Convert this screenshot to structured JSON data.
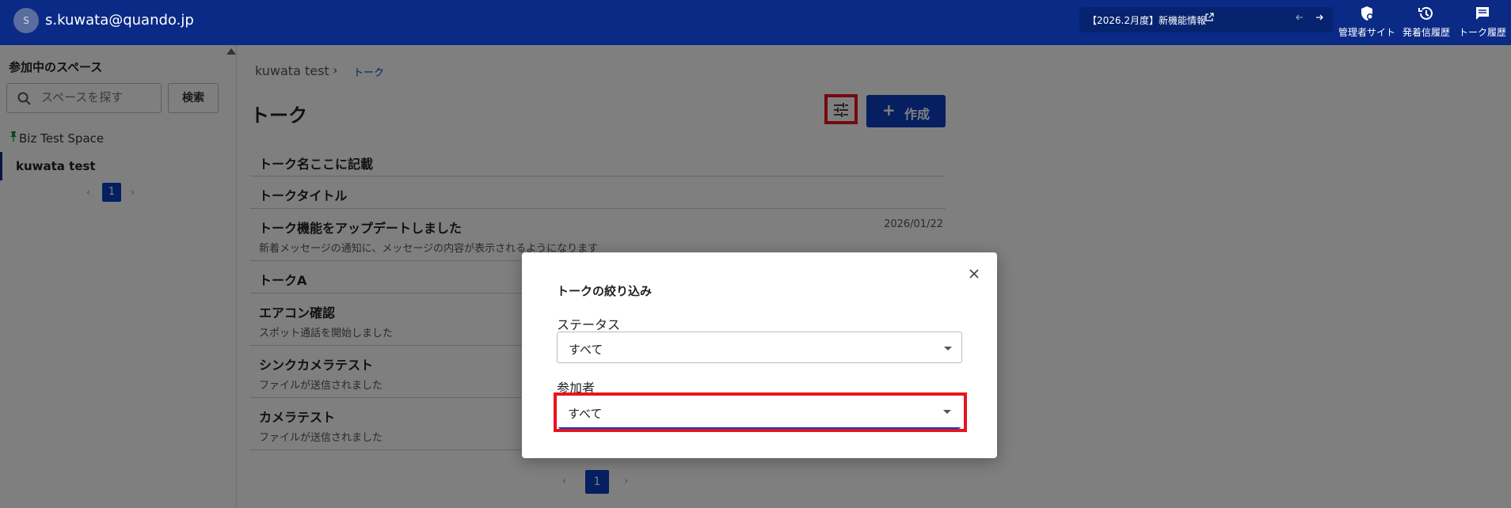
{
  "header": {
    "avatar_initial": "S",
    "user_email": "s.kuwata@quando.jp",
    "news_text": "【2026.2月度】新機能情報",
    "admin_site_label": "管理者サイト",
    "send_history_label": "発着信履歴",
    "talk_history_label": "トーク履歴",
    "bg_color": "#0a2a86"
  },
  "sidebar": {
    "title": "参加中のスペース",
    "search_placeholder": "スペースを探す",
    "search_button": "検索",
    "spaces": [
      {
        "label": "Biz Test Space",
        "pinned": true
      },
      {
        "label": "kuwata test",
        "active": true
      }
    ],
    "page": "1"
  },
  "main": {
    "breadcrumb_root": "kuwata test",
    "breadcrumb_sep": "›",
    "breadcrumb_current": "トーク",
    "title": "トーク",
    "create_label": "作成",
    "talks": [
      {
        "title": "トーク名ここに記載",
        "subtitle": "",
        "date": ""
      },
      {
        "title": "トークタイトル",
        "subtitle": "",
        "date": ""
      },
      {
        "title": "トーク機能をアップデートしました",
        "subtitle": "新着メッセージの通知に、メッセージの内容が表示されるようになります",
        "date": "2026/01/22"
      },
      {
        "title": "トークA",
        "subtitle": "",
        "date": ""
      },
      {
        "title": "エアコン確認",
        "subtitle": "スポット通話を開始しました",
        "date": ""
      },
      {
        "title": "シンクカメラテスト",
        "subtitle": "ファイルが送信されました",
        "date": ""
      },
      {
        "title": "カメラテスト",
        "subtitle": "ファイルが送信されました",
        "date": ""
      }
    ],
    "page": "1"
  },
  "modal": {
    "title": "トークの絞り込み",
    "status_label": "ステータス",
    "status_value": "すべて",
    "participant_label": "参加者",
    "participant_value": "すべて"
  },
  "colors": {
    "accent": "#0a3fc3",
    "highlight": "#e8141c"
  }
}
